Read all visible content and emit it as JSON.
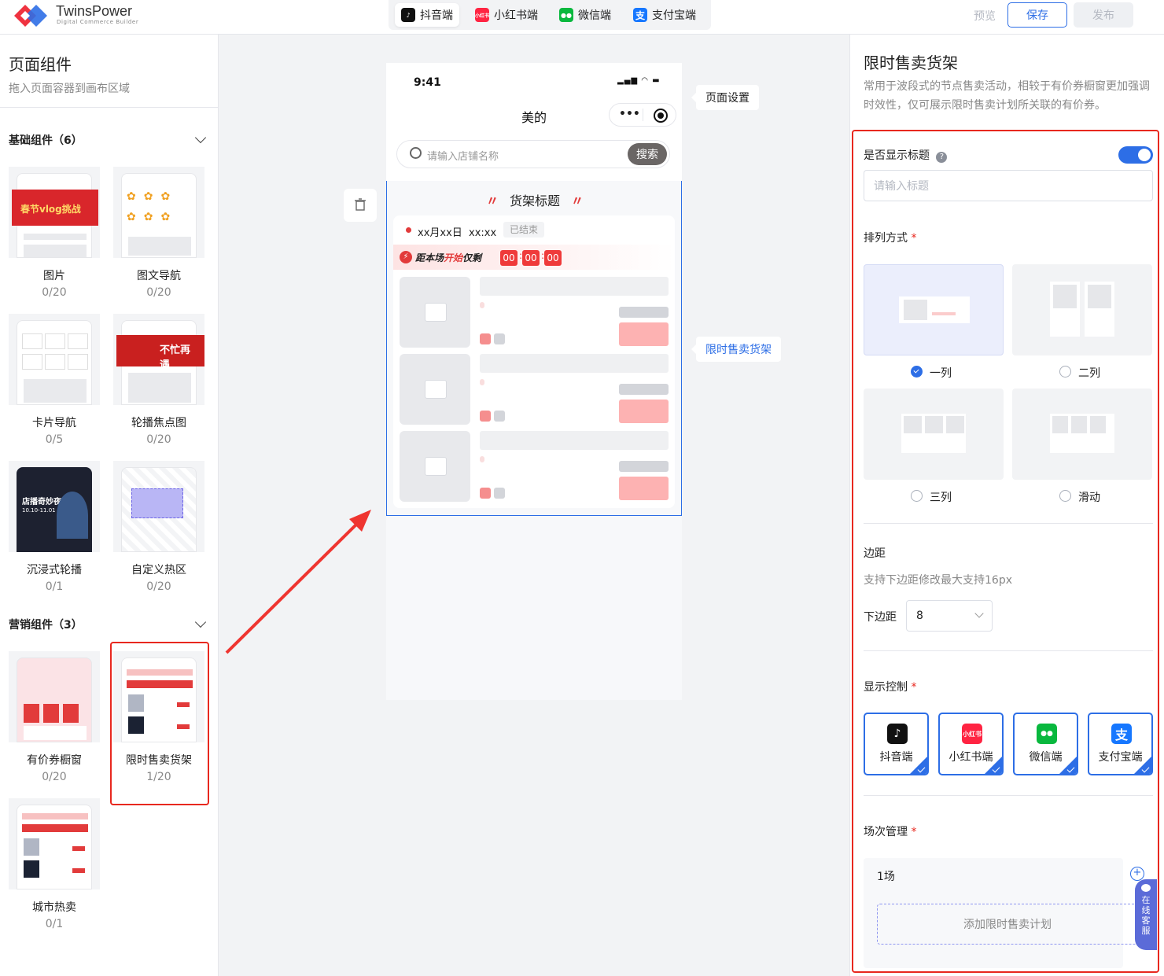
{
  "header": {
    "brand": "TwinsPower",
    "brand_sub": "Digital Commerce Builder",
    "platform_tabs": [
      {
        "label": "抖音端",
        "icon": "douyin-icon",
        "color": "#111111",
        "active": true
      },
      {
        "label": "小红书端",
        "icon": "xiaohongshu-icon",
        "color": "#ff2442",
        "active": false
      },
      {
        "label": "微信端",
        "icon": "wechat-icon",
        "color": "#09b83e",
        "active": false
      },
      {
        "label": "支付宝端",
        "icon": "alipay-icon",
        "color": "#1677ff",
        "active": false
      }
    ],
    "preview": "预览",
    "save": "保存",
    "publish": "发布"
  },
  "left": {
    "title": "页面组件",
    "subtitle": "拖入页面容器到画布区域",
    "basic_section": "基础组件（6）",
    "marketing_section": "营销组件（3）",
    "basic_items": [
      {
        "name": "图片",
        "count": "0/20"
      },
      {
        "name": "图文导航",
        "count": "0/20"
      },
      {
        "name": "卡片导航",
        "count": "0/5"
      },
      {
        "name": "轮播焦点图",
        "count": "0/20"
      },
      {
        "name": "沉浸式轮播",
        "count": "0/1"
      },
      {
        "name": "自定义热区",
        "count": "0/20"
      }
    ],
    "marketing_items": [
      {
        "name": "有价券橱窗",
        "count": "0/20"
      },
      {
        "name": "限时售卖货架",
        "count": "1/20"
      },
      {
        "name": "城市热卖",
        "count": "0/1"
      }
    ],
    "thumb_text": {
      "banner_title": "春节vlog挑战",
      "carousel_text": "不忙再遇",
      "immersive_title": "店播奇妙夜",
      "immersive_date": "10.10-11.01"
    }
  },
  "canvas": {
    "time": "9:41",
    "page_title": "美的",
    "search_placeholder": "请输入店铺名称",
    "search_button": "搜索",
    "shelf_title": "货架标题",
    "session_time": "xx月xx日  xx:xx",
    "session_status": "已结束",
    "countdown_prefix": "距本场",
    "countdown_highlight": "开始",
    "countdown_suffix": "仅剩",
    "countdown": [
      "00",
      "00",
      "00"
    ],
    "tip_page_settings": "页面设置",
    "tip_component": "限时售卖货架"
  },
  "right": {
    "title": "限时售卖货架",
    "description": "常用于波段式的节点售卖活动，相较于有价券橱窗更加强调时效性，仅可展示限时售卖计划所关联的有价券。",
    "show_title_label": "是否显示标题",
    "show_title_on": true,
    "title_placeholder": "请输入标题",
    "arrange_label": "排列方式",
    "layouts": [
      {
        "label": "一列",
        "selected": true
      },
      {
        "label": "二列",
        "selected": false
      },
      {
        "label": "三列",
        "selected": false
      },
      {
        "label": "滑动",
        "selected": false
      }
    ],
    "margin_label": "边距",
    "margin_hint": "支持下边距修改最大支持16px",
    "bottom_margin_label": "下边距",
    "bottom_margin_value": "8",
    "display_label": "显示控制",
    "display_items": [
      {
        "label": "抖音端",
        "icon": "douyin-icon",
        "color": "#111111"
      },
      {
        "label": "小红书端",
        "icon": "xiaohongshu-icon",
        "color": "#ff2442",
        "icon_text": "小红书"
      },
      {
        "label": "微信端",
        "icon": "wechat-icon",
        "color": "#09b83e"
      },
      {
        "label": "支付宝端",
        "icon": "alipay-icon",
        "color": "#1677ff"
      }
    ],
    "session_label": "场次管理",
    "session_value": "1场",
    "add_plan": "添加限时售卖计划",
    "service": "在线客服",
    "required_mark": "*"
  }
}
